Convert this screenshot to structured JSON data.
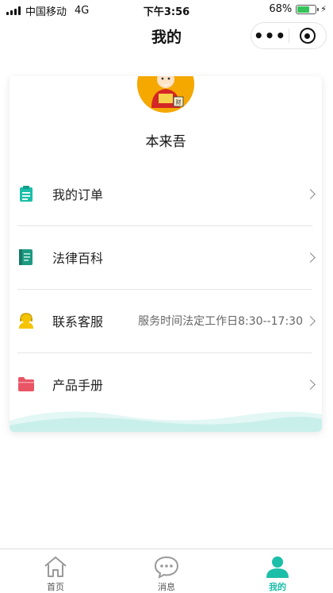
{
  "status_bar": {
    "carrier": "中国移动",
    "network": "4G",
    "time": "下午3:56",
    "battery_text": "68%",
    "battery_level": 0.68
  },
  "nav": {
    "title": "我的",
    "more_icon": "more-dots-icon",
    "close_icon": "target-circle-icon"
  },
  "profile": {
    "username": "本来吾",
    "avatar": "god-of-wealth-avatar"
  },
  "menu": [
    {
      "label": "我的订单",
      "extra": "",
      "icon": "clipboard-icon",
      "color": "#1bbfa8"
    },
    {
      "label": "法律百科",
      "extra": "",
      "icon": "book-icon",
      "color": "#1f9a82"
    },
    {
      "label": "联系客服",
      "extra": "服务时间法定工作日8:30--17:30",
      "icon": "customer-service-icon",
      "color": "#f5c400"
    },
    {
      "label": "产品手册",
      "extra": "",
      "icon": "folder-icon",
      "color": "#e85565"
    }
  ],
  "tabbar": [
    {
      "label": "首页",
      "icon": "home-icon",
      "active": false
    },
    {
      "label": "消息",
      "icon": "message-icon",
      "active": false
    },
    {
      "label": "我的",
      "icon": "user-icon",
      "active": true
    }
  ],
  "colors": {
    "accent": "#1bbfa8",
    "wave": "#cff1ee"
  }
}
